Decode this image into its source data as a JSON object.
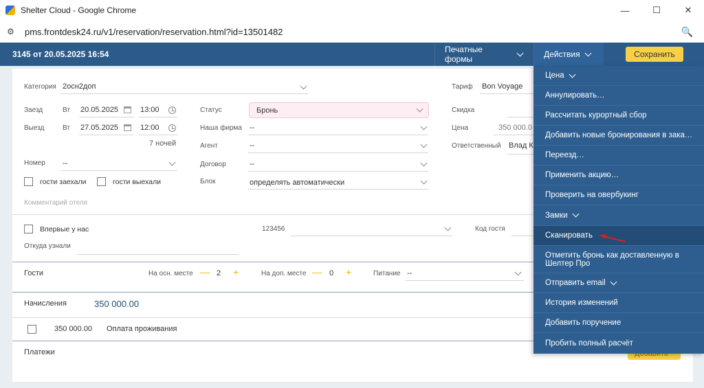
{
  "window": {
    "title": "Shelter Cloud - Google Chrome",
    "controls": {
      "minimize": "—",
      "maximize": "☐",
      "close": "✕"
    }
  },
  "address_bar": {
    "site_icon": "⚙",
    "url": "pms.frontdesk24.ru/v1/reservation/reservation.html?id=13501482",
    "zoom_icon": "🔍"
  },
  "header": {
    "title": "3145 от 20.05.2025 16:54",
    "print_forms": "Печатные формы",
    "actions": "Действия",
    "save": "Сохранить"
  },
  "form": {
    "category_label": "Категория",
    "category_value": "2осн2доп",
    "tariff_label": "Тариф",
    "tariff_value": "Bon Voyage",
    "checkin_label": "Заезд",
    "checkin_day": "Вт",
    "checkin_date": "20.05.2025",
    "checkin_time": "13:00",
    "checkout_label": "Выезд",
    "checkout_day": "Вт",
    "checkout_date": "27.05.2025",
    "checkout_time": "12:00",
    "nights": "7 ночей",
    "status_label": "Статус",
    "status_value": "Бронь",
    "firm_label": "Наша фирма",
    "firm_value": "--",
    "agent_label": "Агент",
    "agent_value": "--",
    "contract_label": "Договор",
    "contract_value": "--",
    "block_label": "Блок",
    "block_value": "определять автоматически",
    "discount_label": "Скидка",
    "price_label": "Цена",
    "price_value": "350 000.0",
    "responsible_label": "Ответственный",
    "responsible_value": "Влад К",
    "room_label": "Номер",
    "room_value": "--",
    "guests_arrived": "гости заехали",
    "guests_left": "гости выехали",
    "hotel_comment": "Комментарий отеля",
    "first_time": "Впервые у нас",
    "guest_code_field": "123456",
    "guest_code_label": "Код гостя",
    "source_label": "Откуда узнали"
  },
  "guests": {
    "label": "Гости",
    "main_label": "На осн. месте",
    "main_value": "2",
    "extra_label": "На доп. месте",
    "extra_value": "0",
    "meal_label": "Питание",
    "meal_value": "--",
    "minus": "—",
    "plus": "+"
  },
  "charges": {
    "label": "Начисления",
    "total": "350 000.00",
    "row_amount": "350 000.00",
    "row_desc": "Оплата проживания"
  },
  "payments": {
    "label": "Платежи",
    "add_button": "Добавить"
  },
  "menu": {
    "items": [
      "Цена",
      "Аннулировать…",
      "Рассчитать курортный сбор",
      "Добавить новые бронирования в заказ…",
      "Переезд…",
      "Применить акцию…",
      "Проверить на овербукинг",
      "Замки",
      "Сканировать",
      "Отметить бронь как доставленную в Шелтер Про",
      "Отправить email",
      "История изменений",
      "Добавить поручение",
      "Пробить полный расчёт"
    ]
  },
  "colors": {
    "header_bg": "#2c5b8a",
    "menu_bg": "#2d5e8f",
    "save_btn": "#f7d046",
    "status_bg": "#fdeef3",
    "arrow": "#d92020"
  }
}
